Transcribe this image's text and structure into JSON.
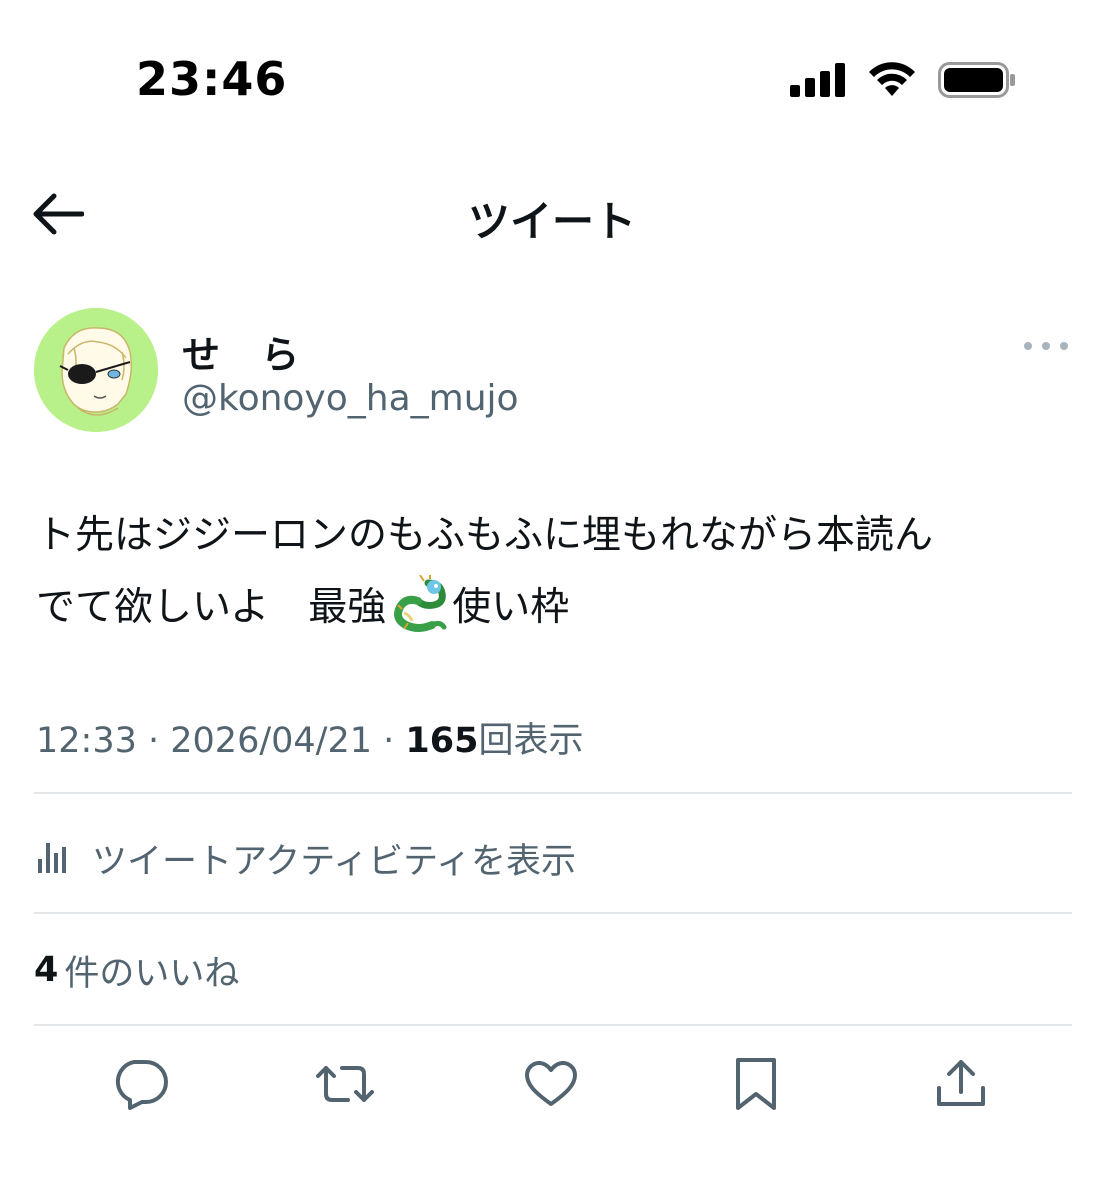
{
  "status_bar": {
    "time": "23:46",
    "icons": [
      "signal-icon",
      "wifi-icon",
      "battery-icon"
    ]
  },
  "nav": {
    "back_icon": "arrow-left-icon",
    "title": "ツイート"
  },
  "author": {
    "display_name": "せ ら",
    "username": "@konoyo_ha_mujo",
    "avatar_bg": "#b8f08a"
  },
  "tweet": {
    "text_line1": "ト先はジジーロンのもふもふに埋もれながら本読ん",
    "text_line2_a": "でて欲しいよ　最強",
    "emoji": "dragon-emoji",
    "text_line2_b": "使い枠"
  },
  "meta": {
    "time": "12:33",
    "sep1": " · ",
    "date": "2026/04/21",
    "sep2": " · ",
    "views": "165",
    "views_label": "回表示"
  },
  "activity": {
    "icon": "analytics-icon",
    "label": "ツイートアクティビティを表示"
  },
  "likes": {
    "count": "4",
    "label": "件のいいね"
  },
  "actions": [
    {
      "icon": "reply-icon"
    },
    {
      "icon": "retweet-icon"
    },
    {
      "icon": "like-icon"
    },
    {
      "icon": "bookmark-icon"
    },
    {
      "icon": "share-icon"
    }
  ],
  "colors": {
    "text_primary": "#0f1419",
    "text_secondary": "#536471",
    "divider": "#e3e7ea",
    "more_dots": "#a8b4bd"
  }
}
